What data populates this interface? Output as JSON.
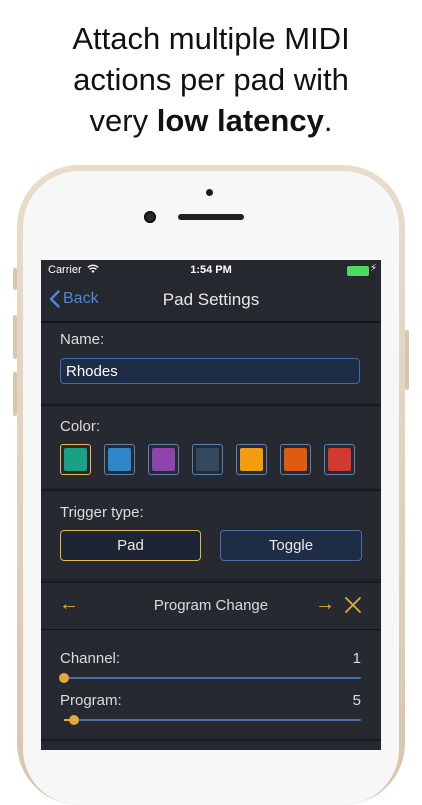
{
  "headline": {
    "line1": "Attach multiple MIDI",
    "line2": "actions per pad with",
    "line3_pre": "very ",
    "line3_bold": "low latency",
    "line3_post": "."
  },
  "status_bar": {
    "carrier": "Carrier",
    "time": "1:54 PM"
  },
  "nav": {
    "back_label": "Back",
    "title": "Pad Settings"
  },
  "name_section": {
    "label": "Name:",
    "value": "Rhodes"
  },
  "color_section": {
    "label": "Color:",
    "swatches": [
      {
        "color": "#1aa085",
        "selected": true
      },
      {
        "color": "#2f86c9",
        "selected": false
      },
      {
        "color": "#8e44ad",
        "selected": false
      },
      {
        "color": "#34495e",
        "selected": false
      },
      {
        "color": "#f39c12",
        "selected": false
      },
      {
        "color": "#e05a10",
        "selected": false
      },
      {
        "color": "#d33a2f",
        "selected": false
      }
    ]
  },
  "trigger_section": {
    "label": "Trigger type:",
    "pad_label": "Pad",
    "toggle_label": "Toggle",
    "selected": "Pad"
  },
  "action": {
    "title": "Program Change",
    "prev_icon": "arrow-left-icon",
    "next_icon": "arrow-right-icon",
    "close_icon": "close-icon"
  },
  "sliders": {
    "channel": {
      "label": "Channel:",
      "value": "1",
      "fraction": 0.0
    },
    "program": {
      "label": "Program:",
      "value": "5",
      "fraction": 0.035
    }
  },
  "colors": {
    "accent": "#e4a93a",
    "link": "#4a89dc",
    "background": "#1e2128"
  }
}
